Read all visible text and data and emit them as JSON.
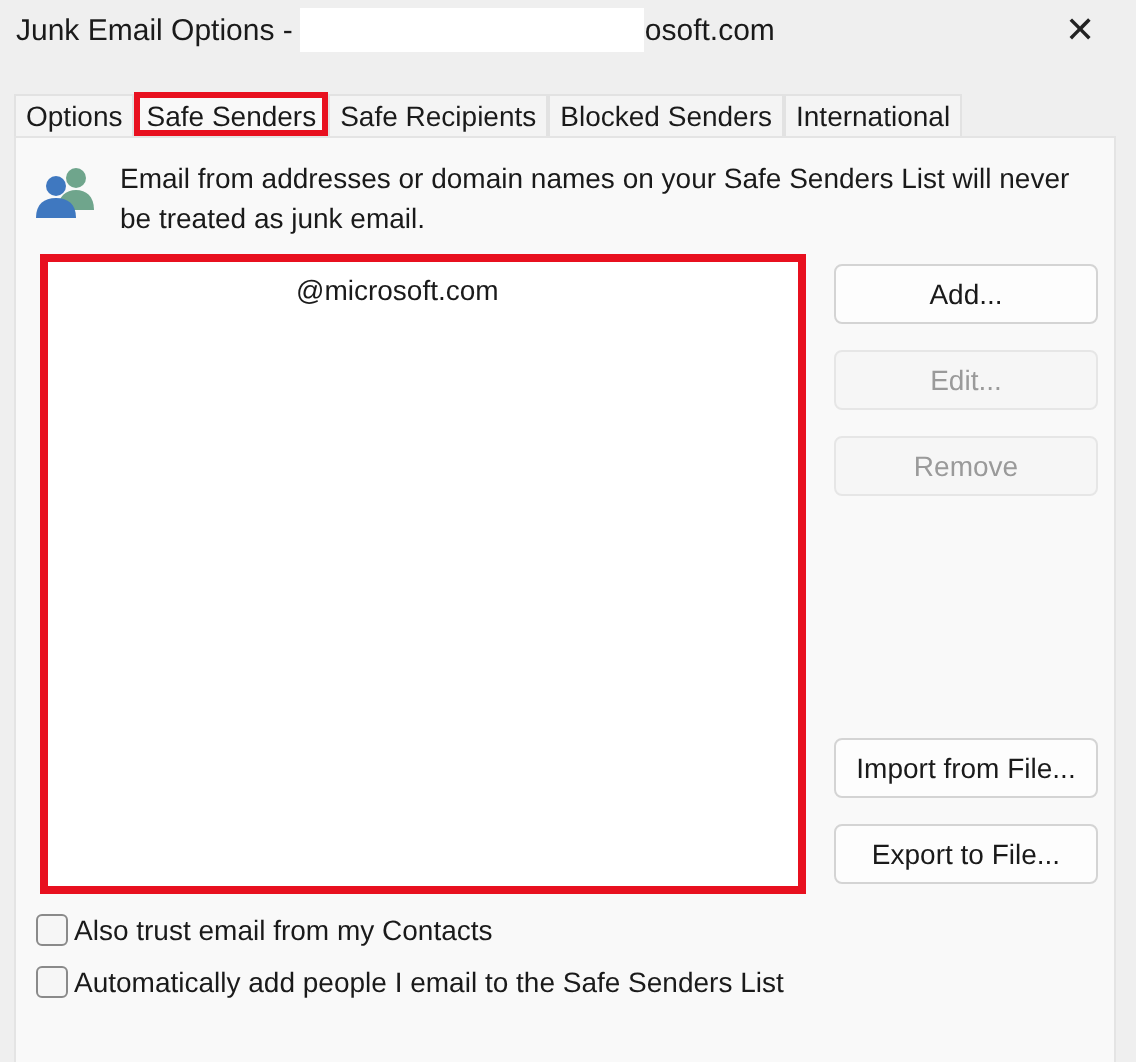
{
  "window": {
    "title": "Junk Email Options -",
    "title_tail": "osoft.com",
    "close": "✕"
  },
  "tabs": [
    {
      "label": "Options",
      "selected": false,
      "highlighted": false
    },
    {
      "label": "Safe Senders",
      "selected": true,
      "highlighted": true
    },
    {
      "label": "Safe Recipients",
      "selected": false,
      "highlighted": false
    },
    {
      "label": "Blocked Senders",
      "selected": false,
      "highlighted": false
    },
    {
      "label": "International",
      "selected": false,
      "highlighted": false
    }
  ],
  "info": "Email from addresses or domain names on your Safe Senders List will never be treated as junk email.",
  "list": {
    "highlighted": true,
    "items": [
      "@microsoft.com"
    ]
  },
  "buttons": [
    {
      "label": "Add...",
      "disabled": false
    },
    {
      "label": "Edit...",
      "disabled": true
    },
    {
      "label": "Remove",
      "disabled": true
    }
  ],
  "file_buttons": [
    {
      "label": "Import from File...",
      "disabled": false
    },
    {
      "label": "Export to File...",
      "disabled": false
    }
  ],
  "options": [
    {
      "label": "Also trust email from my Contacts",
      "checked": false
    },
    {
      "label": "Automatically add people I email to the Safe Senders List",
      "checked": false
    }
  ]
}
